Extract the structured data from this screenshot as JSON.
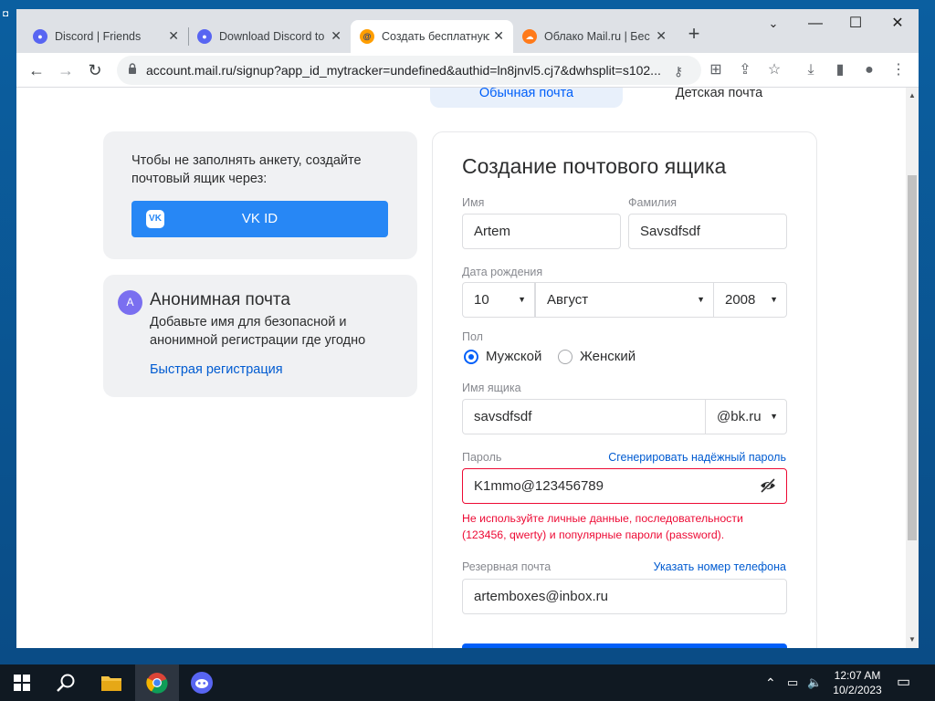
{
  "browser": {
    "tabs": [
      {
        "title": "Discord | Friends",
        "icon": "discord-icon",
        "active": false
      },
      {
        "title": "Download Discord to",
        "icon": "discord-icon",
        "active": false
      },
      {
        "title": "Создать бесплатную",
        "icon": "mailru-icon",
        "active": true
      },
      {
        "title": "Облако Mail.ru | Бес",
        "icon": "cloud-mailru-icon",
        "active": false
      }
    ],
    "new_tab": "+",
    "url": "account.mail.ru/signup?app_id_mytracker=undefined&authid=ln8jnvl5.cj7&dwhsplit=s102..."
  },
  "page": {
    "mode_tabs": {
      "regular": "Обычная почта",
      "kids": "Детская почта"
    },
    "vk_card": {
      "text": "Чтобы не заполнять анкету, создайте почтовый ящик через:",
      "button": "VK ID",
      "logo": "VK"
    },
    "anon_card": {
      "avatar": "A",
      "title": "Анонимная почта",
      "desc": "Добавьте имя для безопасной и анонимной регистрации где угодно",
      "link": "Быстрая регистрация"
    },
    "form": {
      "title": "Создание почтового ящика",
      "first_name_label": "Имя",
      "first_name": "Artem",
      "last_name_label": "Фамилия",
      "last_name": "Savsdfsdf",
      "dob_label": "Дата рождения",
      "dob_day": "10",
      "dob_month": "Август",
      "dob_year": "2008",
      "gender_label": "Пол",
      "gender_male": "Мужской",
      "gender_female": "Женский",
      "gender_selected": "male",
      "mailbox_label": "Имя ящика",
      "mailbox": "savsdfsdf",
      "domain": "@bk.ru",
      "password_label": "Пароль",
      "password_generate": "Сгенерировать надёжный пароль",
      "password": "K1mmo@123456789",
      "password_error": "Не используйте личные данные, последовательности (123456, qwerty) и популярные пароли (password).",
      "backup_label": "Резервная почта",
      "backup_phone_link": "Указать номер телефона",
      "backup_email": "artemboxes@inbox.ru"
    }
  },
  "taskbar": {
    "time": "12:07 AM",
    "date": "10/2/2023",
    "apps": [
      "start",
      "search",
      "file-explorer",
      "chrome",
      "discord"
    ]
  },
  "colors": {
    "accent": "#005ff9",
    "error": "#ed0a34",
    "vk": "#2787f5"
  }
}
